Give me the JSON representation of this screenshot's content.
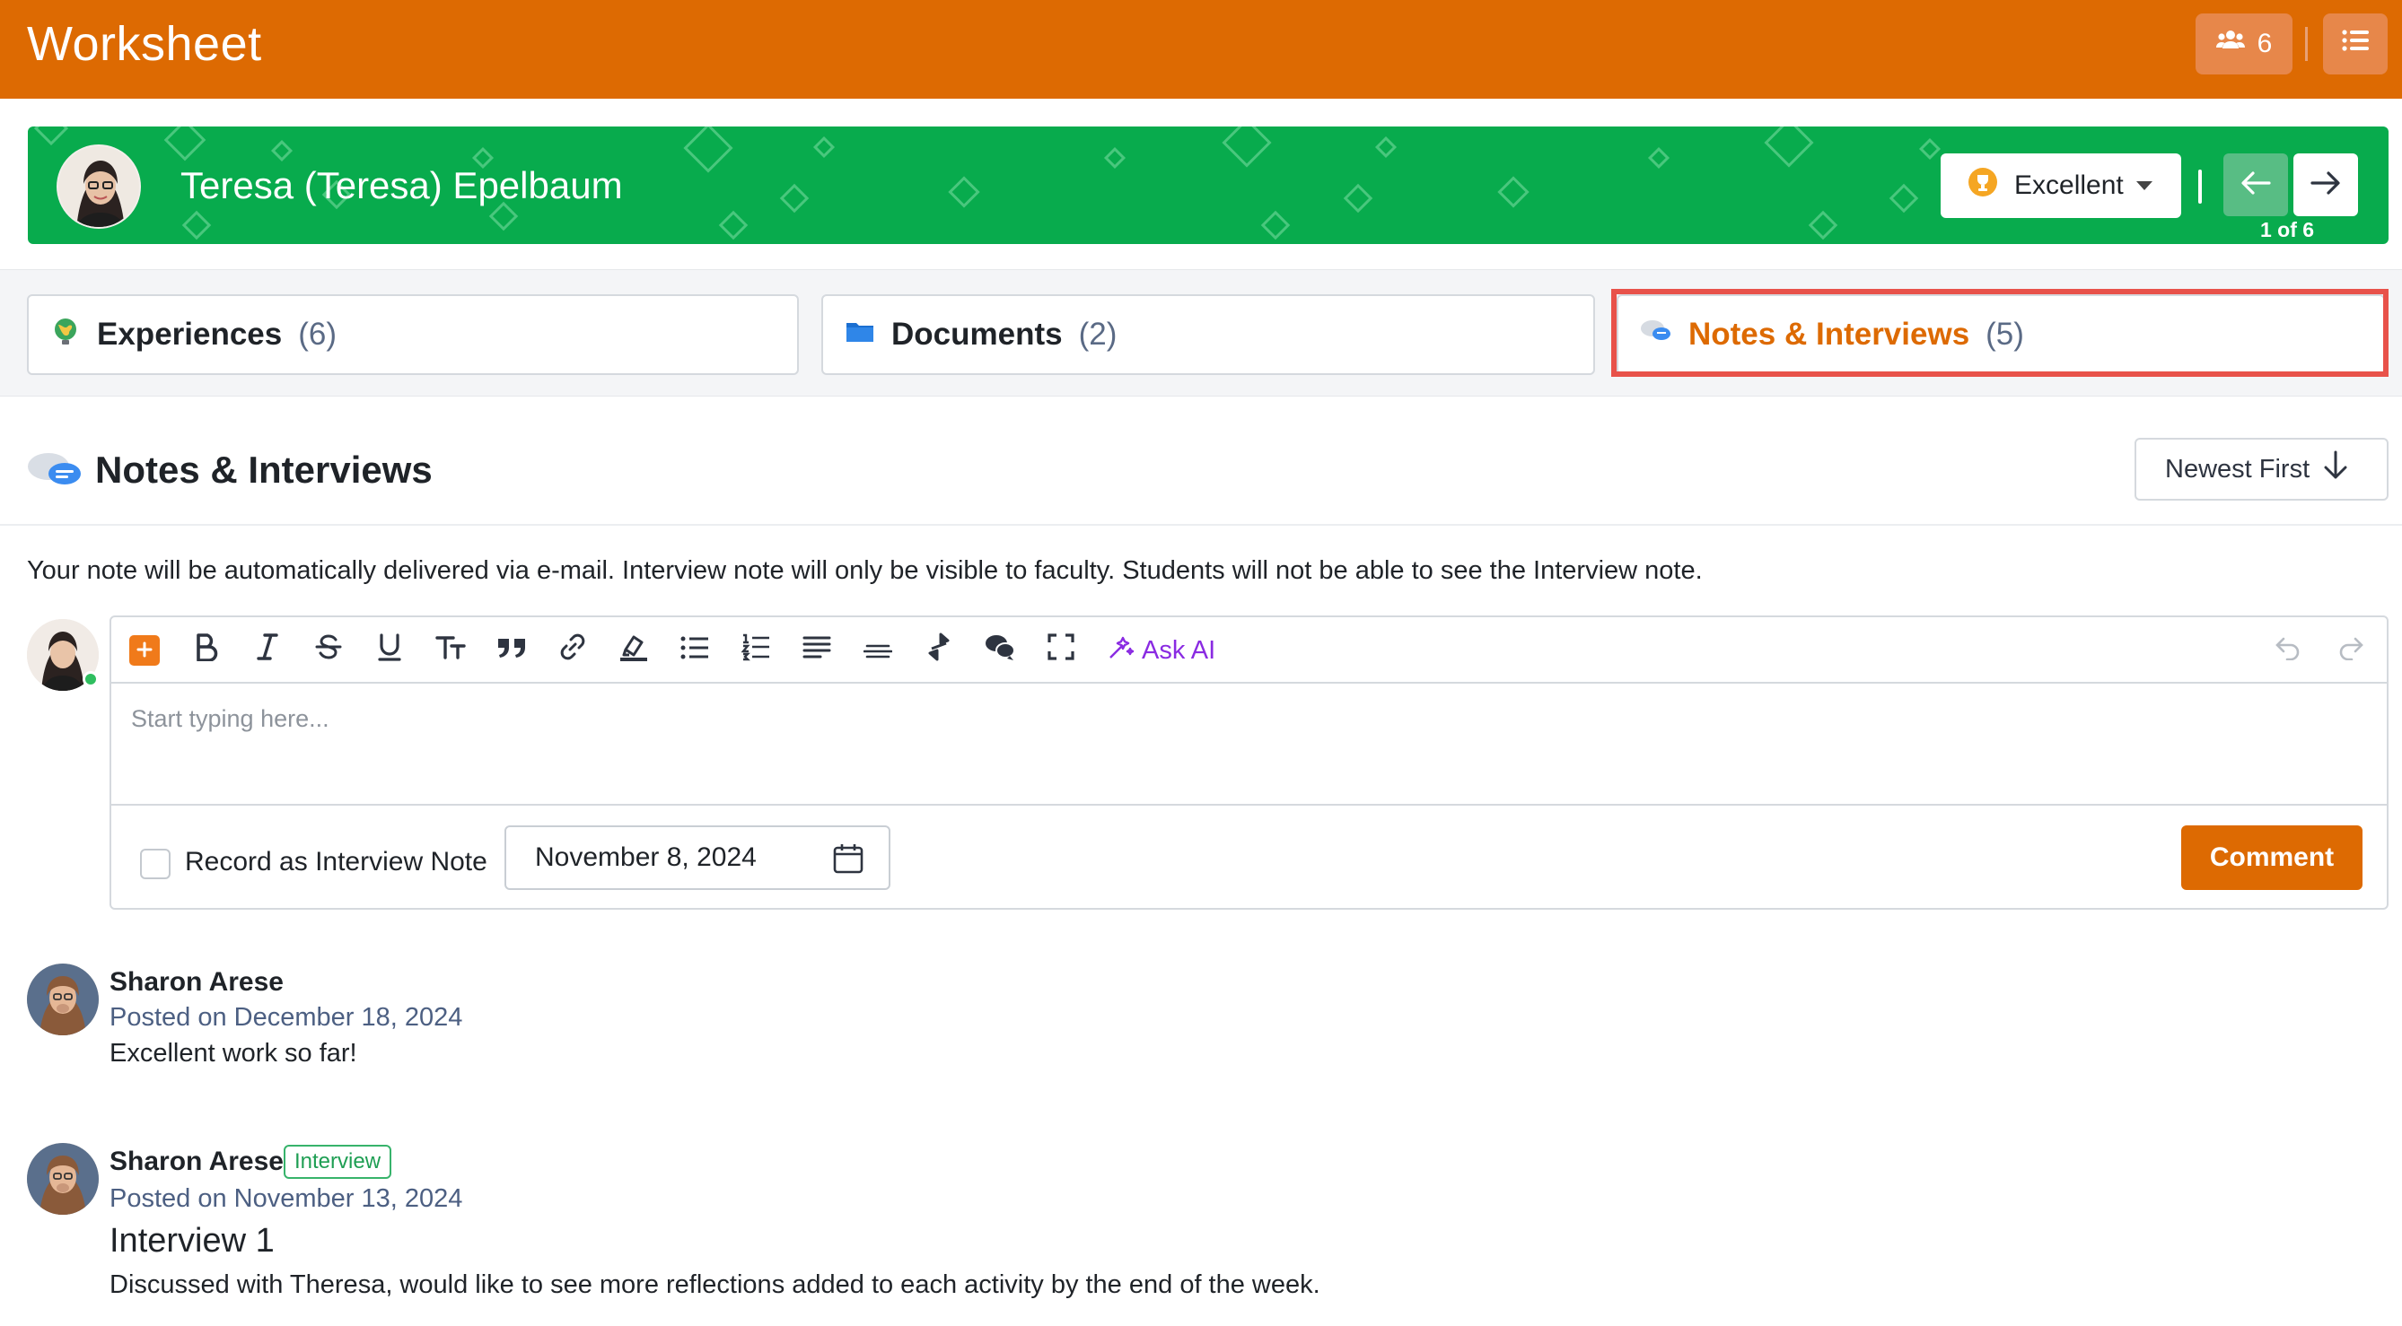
{
  "app": {
    "title": "Worksheet"
  },
  "topbar": {
    "users_count": "6"
  },
  "student": {
    "name": "Teresa (Teresa) Epelbaum",
    "rating": "Excellent",
    "pager": "1 of 6"
  },
  "tabs": [
    {
      "label": "Experiences",
      "count": "(6)"
    },
    {
      "label": "Documents",
      "count": "(2)"
    },
    {
      "label": "Notes & Interviews",
      "count": "(5)",
      "active": true
    }
  ],
  "section": {
    "title": "Notes & Interviews",
    "sort_label": "Newest First"
  },
  "notice": "Your note will be automatically delivered via e-mail. Interview note will only be visible to faculty. Students will not be able to see the Interview note.",
  "composer": {
    "ask_ai_label": "Ask AI",
    "placeholder": "Start typing here...",
    "interview_checkbox_label": "Record as Interview Note",
    "interview_checked": false,
    "date_value": "November 8, 2024",
    "submit_label": "Comment"
  },
  "comments": [
    {
      "author": "Sharon Arese",
      "posted": "Posted on December 18, 2024",
      "body": "Excellent work so far!"
    },
    {
      "author": "Sharon Arese",
      "badge": "Interview",
      "posted": "Posted on November 13, 2024",
      "title": "Interview 1",
      "body": "Discussed with Theresa, would like to see more reflections added to each activity by the end of the week."
    }
  ],
  "colors": {
    "brand_orange": "#dd6a02",
    "banner_green": "#08ab4d",
    "highlight_red": "#e8524a",
    "ai_purple": "#8a2be2"
  }
}
